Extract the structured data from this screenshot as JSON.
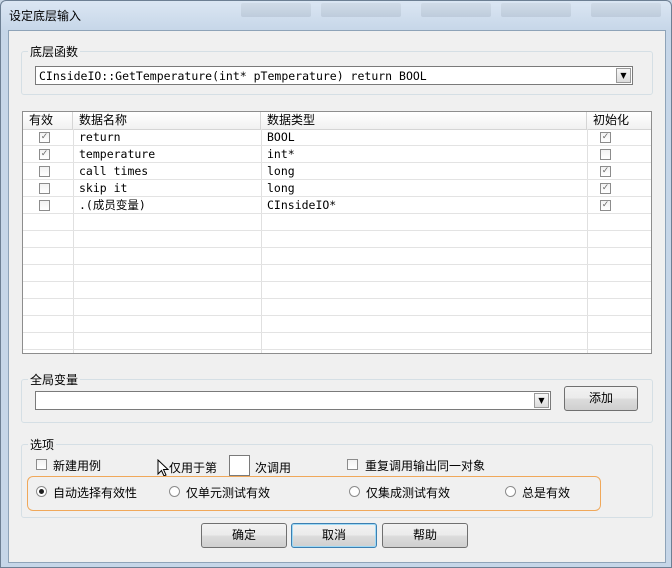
{
  "window": {
    "title": "设定底层输入"
  },
  "function_group": {
    "label": "底层函数",
    "selected": "CInsideIO::GetTemperature(int* pTemperature) return BOOL"
  },
  "table": {
    "columns": [
      "有效",
      "数据名称",
      "数据类型",
      "初始化"
    ],
    "rows": [
      {
        "valid": true,
        "name": "return",
        "type": "BOOL",
        "init": true
      },
      {
        "valid": true,
        "name": "temperature",
        "type": "int*",
        "init": false
      },
      {
        "valid": false,
        "name": "call times",
        "type": "long",
        "init": true
      },
      {
        "valid": false,
        "name": "skip it",
        "type": "long",
        "init": true
      },
      {
        "valid": false,
        "name": ".(成员变量)",
        "type": "CInsideIO*",
        "init": true
      }
    ]
  },
  "global_group": {
    "label": "全局变量",
    "value": "",
    "add_button": "添加"
  },
  "options_group": {
    "label": "选项",
    "new_case": "新建用例",
    "only_for": "仅用于第",
    "call_count_value": "",
    "call_suffix": "次调用",
    "repeat_same": "重复调用输出同一对象",
    "radios": [
      {
        "label": "自动选择有效性",
        "selected": true
      },
      {
        "label": "仅单元测试有效",
        "selected": false
      },
      {
        "label": "仅集成测试有效",
        "selected": false
      },
      {
        "label": "总是有效",
        "selected": false
      }
    ]
  },
  "buttons": {
    "ok": "确定",
    "cancel": "取消",
    "help": "帮助"
  },
  "colors": {
    "highlight": "#f0a85a",
    "title_bg": "#c6d6e8"
  }
}
